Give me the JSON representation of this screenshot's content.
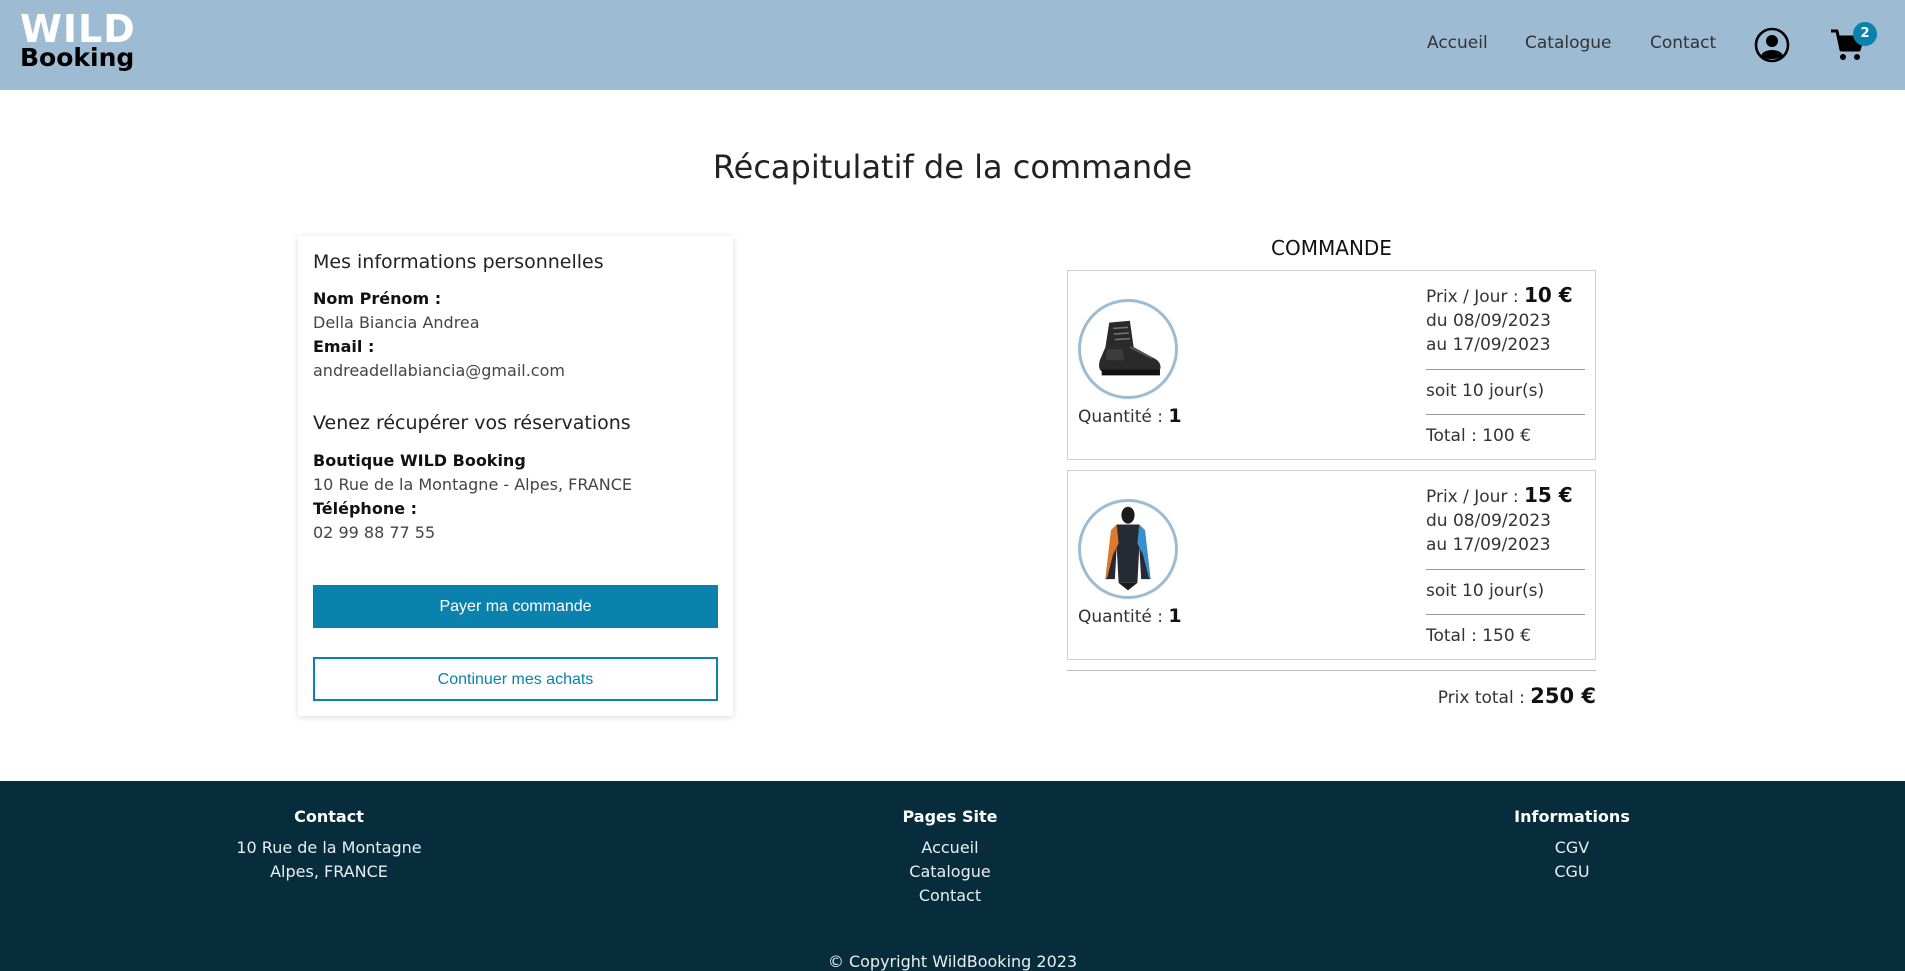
{
  "header": {
    "logo_top": "WILD",
    "logo_bottom": "Booking",
    "nav": [
      "Accueil",
      "Catalogue",
      "Contact"
    ],
    "cart_count": "2",
    "icons": [
      "user-circle-icon",
      "cart-icon"
    ],
    "bg_color": "#9dbcd4"
  },
  "main": {
    "title": "Récapitulatif de la commande"
  },
  "personal": {
    "heading": "Mes informations personnelles",
    "name_label": "Nom Prénom :",
    "name_value": "Della Biancia Andrea",
    "email_label": "Email :",
    "email_value": "andreadellabiancia@gmail.com",
    "pickup_heading": "Venez récupérer vos réservations",
    "shop_name": "Boutique WILD Booking",
    "shop_address": "10 Rue de la Montagne - Alpes, FRANCE",
    "phone_label": "Téléphone :",
    "phone_value": "02 99 88 77 55",
    "pay_button": "Payer ma commande",
    "continue_button": "Continuer mes achats",
    "accent_color": "#0b82ad"
  },
  "order": {
    "title": "COMMANDE",
    "items": [
      {
        "image": "hiking-boot",
        "qty_label": "Quantité :",
        "qty": "1",
        "price_label": "Prix / Jour :",
        "price": "10 €",
        "from": "du 08/09/2023",
        "to": "au 17/09/2023",
        "days": "soit 10 jour(s)",
        "total": "Total : 100 €"
      },
      {
        "image": "wetsuit",
        "qty_label": "Quantité :",
        "qty": "1",
        "price_label": "Prix / Jour :",
        "price": "15 €",
        "from": "du 08/09/2023",
        "to": "au 17/09/2023",
        "days": "soit 10 jour(s)",
        "total": "Total : 150 €"
      }
    ],
    "grand_total_label": "Prix total :",
    "grand_total": "250 €"
  },
  "footer": {
    "contact_heading": "Contact",
    "contact_lines": [
      "10 Rue de la Montagne",
      "Alpes, FRANCE"
    ],
    "pages_heading": "Pages Site",
    "pages_links": [
      "Accueil",
      "Catalogue",
      "Contact"
    ],
    "info_heading": "Informations",
    "info_links": [
      "CGV",
      "CGU"
    ],
    "copyright": "© Copyright WildBooking 2023",
    "bg_color": "#072c3c"
  }
}
